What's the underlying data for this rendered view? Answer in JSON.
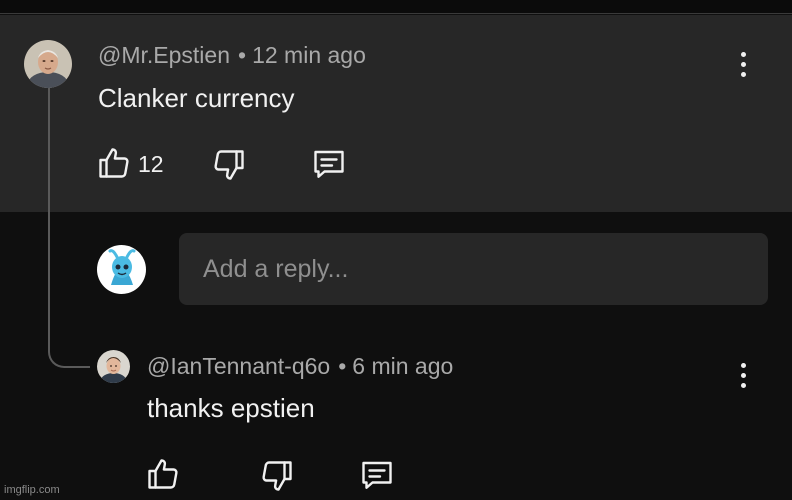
{
  "comment": {
    "author": "@Mr.Epstien",
    "separator": "•",
    "time": "12 min ago",
    "text": "Clanker currency",
    "like_count": "12",
    "icons": {
      "like": "thumbs-up-icon",
      "dislike": "thumbs-down-icon",
      "reply": "reply-icon",
      "more": "more-vert-icon"
    }
  },
  "reply_input": {
    "placeholder": "Add a reply..."
  },
  "reply": {
    "author": "@IanTennant-q6o",
    "separator": "•",
    "time": "6 min ago",
    "text": "thanks epstien",
    "icons": {
      "like": "thumbs-up-icon",
      "dislike": "thumbs-down-icon",
      "reply": "reply-icon",
      "more": "more-vert-icon"
    }
  },
  "watermark": "imgflip.com",
  "colors": {
    "background": "#0f0f0f",
    "card": "#272727",
    "text": "#f1f1f1",
    "meta": "#a9a9a9",
    "placeholder": "#8f8f8f"
  }
}
